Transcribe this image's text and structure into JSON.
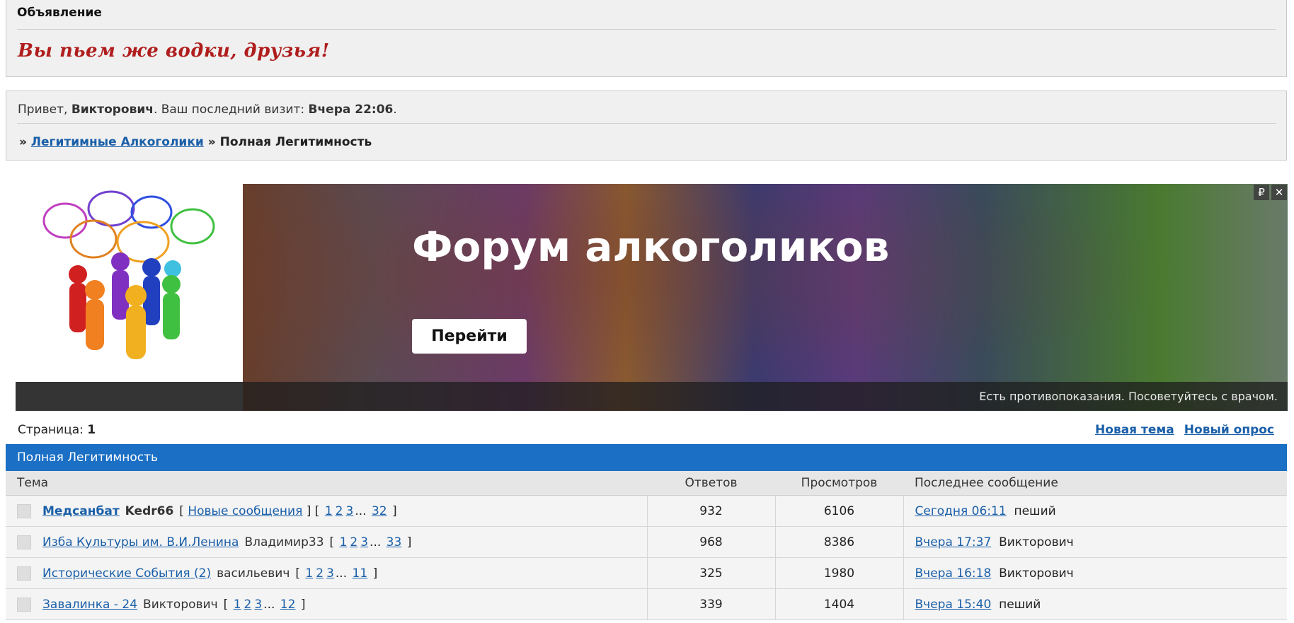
{
  "announcement": {
    "title": "Объявление",
    "message": "Вы пьем же водки, друзья!"
  },
  "welcome": {
    "greeting_prefix": "Привет, ",
    "username": "Викторович",
    "visit_prefix": ".  Ваш последний визит: ",
    "last_visit": "Вчера 22:06",
    "visit_suffix": "."
  },
  "breadcrumb": {
    "sep1": "» ",
    "forum_link": "Легитимные Алкоголики",
    "sep2": " » ",
    "current": "Полная Легитимность"
  },
  "ad": {
    "headline": "Форум алкоголиков",
    "button": "Перейти",
    "warning": "Есть противопоказания. Посоветуйтесь с врачом.",
    "badge": "₽",
    "close": "✕"
  },
  "pager": {
    "label": "Страница: ",
    "page": "1"
  },
  "actions": {
    "new_topic": "Новая тема",
    "new_poll": "Новый опрос"
  },
  "forum": {
    "title": "Полная Легитимность",
    "columns": {
      "topic": "Тема",
      "replies": "Ответов",
      "views": "Просмотров",
      "last": "Последнее сообщение"
    },
    "topics": [
      {
        "title": "Медсанбат",
        "author": "Kedr66",
        "new_posts": "Новые сообщения",
        "pages": [
          "1",
          "2",
          "3",
          "32"
        ],
        "replies": "932",
        "views": "6106",
        "last_time": "Сегодня 06:11",
        "last_user": "пеший"
      },
      {
        "title": "Изба Культуры им. В.И.Ленина",
        "author": "Владимир33",
        "pages": [
          "1",
          "2",
          "3",
          "33"
        ],
        "replies": "968",
        "views": "8386",
        "last_time": "Вчера 17:37",
        "last_user": "Викторович"
      },
      {
        "title": "Исторические События (2)",
        "author": "васильевич",
        "pages": [
          "1",
          "2",
          "3",
          "11"
        ],
        "replies": "325",
        "views": "1980",
        "last_time": "Вчера 16:18",
        "last_user": "Викторович"
      },
      {
        "title": "Завалинка - 24",
        "author": "Викторович",
        "pages": [
          "1",
          "2",
          "3",
          "12"
        ],
        "replies": "339",
        "views": "1404",
        "last_time": "Вчера 15:40",
        "last_user": "пеший"
      }
    ]
  }
}
